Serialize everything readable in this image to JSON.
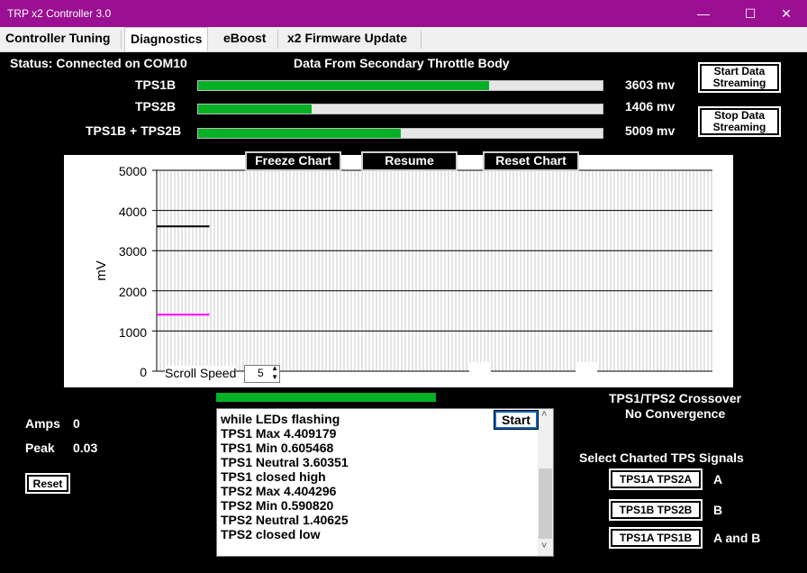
{
  "window": {
    "title": "TRP x2  Controller 3.0",
    "minimize": "—",
    "maximize": "☐",
    "close": "✕"
  },
  "tabs": [
    {
      "label": "Controller Tuning"
    },
    {
      "label": "Diagnostics"
    },
    {
      "label": "eBoost"
    },
    {
      "label": "x2 Firmware Update"
    }
  ],
  "status": "Status: Connected on COM10",
  "section_title": "Data From Secondary Throttle Body",
  "readings": [
    {
      "label": "TPS1B",
      "value": "3603 mv",
      "fill": 0.72
    },
    {
      "label": "TPS2B",
      "value": "1406 mv",
      "fill": 0.28
    },
    {
      "label": "TPS1B + TPS2B",
      "value": "5009 mv",
      "fill": 0.5
    }
  ],
  "buttons": {
    "start_streaming": "Start Data Streaming",
    "stop_streaming": "Stop Data Streaming",
    "freeze": "Freeze Chart",
    "resume": "Resume",
    "reset_chart": "Reset Chart",
    "reset": "Reset",
    "start": "Start",
    "sel_a": "TPS1A  TPS2A",
    "sel_b": "TPS1B  TPS2B",
    "sel_ab": "TPS1A  TPS1B"
  },
  "chart": {
    "ylabel": "mV",
    "ticks": [
      "5000",
      "4000",
      "3000",
      "2000",
      "1000",
      "0"
    ],
    "scroll_speed_label": "Scroll Speed",
    "scroll_speed_value": "5"
  },
  "chart_data": {
    "type": "line",
    "ylabel": "mV",
    "ylim": [
      0,
      5000
    ],
    "series": [
      {
        "color": "#000000",
        "values": [
          3603,
          3603,
          3603,
          3603,
          3603,
          3603,
          3603,
          3603,
          3603,
          3603
        ]
      },
      {
        "color": "#ff00ff",
        "values": [
          1406,
          1406,
          1406,
          1406,
          1406,
          1406,
          1406,
          1406,
          1406,
          1406
        ]
      }
    ]
  },
  "amps": {
    "label": "Amps",
    "value": "0"
  },
  "peak": {
    "label": "Peak",
    "value": "0.03"
  },
  "progress": 1.0,
  "crossover": {
    "title": "TPS1/TPS2 Crossover",
    "result": "No Convergence"
  },
  "select_title": "Select Charted TPS Signals",
  "select_labels": {
    "a": "A",
    "b": "B",
    "ab": "A and B"
  },
  "log": [
    "while LEDs flashing",
    "TPS1 Max 4.409179",
    "TPS1 Min 0.605468",
    "TPS1 Neutral 3.60351",
    "TPS1 closed high",
    "TPS2 Max 4.404296",
    "TPS2 Min 0.590820",
    "TPS2 Neutral 1.40625",
    "TPS2 closed low"
  ]
}
